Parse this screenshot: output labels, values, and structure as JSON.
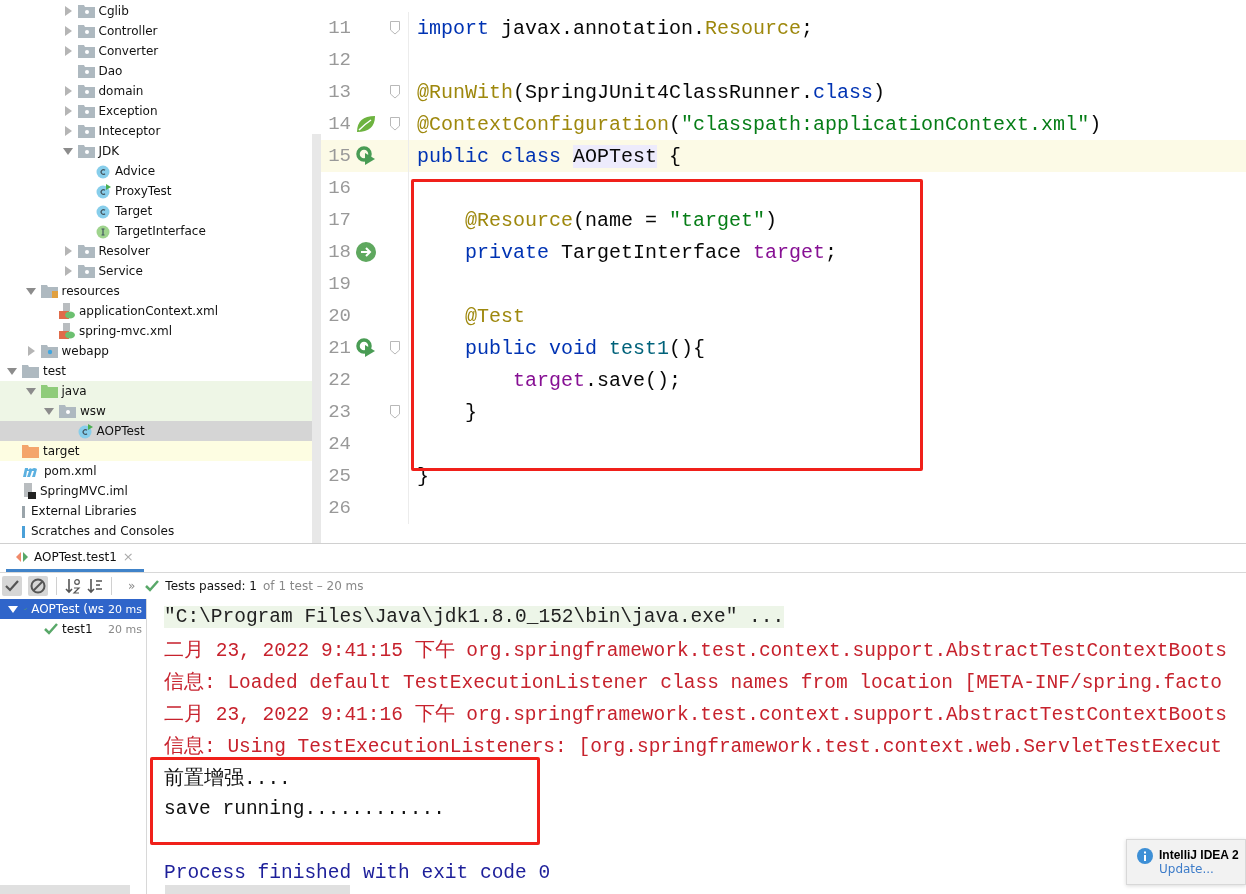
{
  "project_tree": [
    {
      "children": [
        {
          "children": [
            {
              "children": [
                {
                  "label": "Cglib",
                  "kind": "folder",
                  "expanded": false,
                  "selected": false
                },
                {
                  "label": "Controller",
                  "kind": "folder",
                  "expanded": false,
                  "selected": false
                },
                {
                  "label": "Converter",
                  "kind": "folder",
                  "expanded": false,
                  "selected": false
                },
                {
                  "label": "Dao",
                  "kind": "folder",
                  "selected": false
                },
                {
                  "label": "domain",
                  "kind": "folder",
                  "expanded": false,
                  "selected": false
                },
                {
                  "label": "Exception",
                  "kind": "folder",
                  "expanded": false,
                  "selected": false
                },
                {
                  "label": "Inteceptor",
                  "kind": "folder",
                  "expanded": false,
                  "selected": false
                },
                {
                  "label": "JDK",
                  "kind": "folder",
                  "expanded": true,
                  "selected": false,
                  "children": [
                    {
                      "label": "Advice",
                      "kind": "class",
                      "selected": false
                    },
                    {
                      "label": "ProxyTest",
                      "kind": "test-class",
                      "selected": false
                    },
                    {
                      "label": "Target",
                      "kind": "class",
                      "selected": false
                    },
                    {
                      "label": "TargetInterface",
                      "kind": "interface",
                      "selected": false
                    }
                  ]
                },
                {
                  "label": "Resolver",
                  "kind": "folder",
                  "expanded": false,
                  "selected": false
                },
                {
                  "label": "Service",
                  "kind": "folder",
                  "expanded": false,
                  "selected": false
                }
              ]
            }
          ]
        },
        {
          "label": "resources",
          "kind": "resource-folder",
          "expanded": true,
          "selected": false,
          "children": [
            {
              "label": "applicationContext.xml",
              "kind": "xml",
              "selected": false
            },
            {
              "label": "spring-mvc.xml",
              "kind": "xml",
              "selected": false
            }
          ]
        },
        {
          "label": "webapp",
          "kind": "web-folder",
          "expanded": false,
          "selected": false
        }
      ]
    },
    {
      "label": "test",
      "kind": "folder-plain",
      "expanded": true,
      "selected": false,
      "children": [
        {
          "label": "java",
          "kind": "test-root",
          "expanded": true,
          "selected": false,
          "children": [
            {
              "label": "wsw",
              "kind": "folder",
              "expanded": true,
              "selected": false,
              "children": [
                {
                  "label": "AOPTest",
                  "kind": "test-class",
                  "selected": true
                }
              ]
            }
          ]
        }
      ]
    },
    {
      "label": "target",
      "kind": "excluded-folder",
      "selected": false
    },
    {
      "label": "pom.xml",
      "kind": "maven",
      "selected": false
    },
    {
      "label": "SpringMVC.iml",
      "kind": "iml",
      "selected": false
    },
    {
      "label": "External Libraries",
      "kind": "library",
      "selected": false
    },
    {
      "label": "Scratches and Consoles",
      "kind": "scratch",
      "selected": false
    }
  ],
  "editor": {
    "lines": [
      {
        "number": "11",
        "fold": true,
        "tokens": [
          {
            "text": "import",
            "kind": "keyword"
          },
          {
            "text": " javax.annotation.",
            "kind": "plain"
          },
          {
            "text": "Resource",
            "kind": "annotation"
          },
          {
            "text": ";",
            "kind": "plain"
          }
        ]
      },
      {
        "number": "12",
        "fold": false
      },
      {
        "number": "13",
        "fold": true,
        "tokens": [
          {
            "text": "@RunWith",
            "kind": "annotation"
          },
          {
            "text": "(SpringJUnit4ClassRunner.",
            "kind": "plain"
          },
          {
            "text": "class",
            "kind": "keyword"
          },
          {
            "text": ")",
            "kind": "plain"
          }
        ]
      },
      {
        "number": "14",
        "fold": true,
        "kind": "spring",
        "tokens": [
          {
            "text": "@ContextConfiguration",
            "kind": "annotation"
          },
          {
            "text": "(",
            "kind": "plain"
          },
          {
            "text": "\"classpath:applicationContext.xml\"",
            "kind": "string"
          },
          {
            "text": ")",
            "kind": "plain"
          }
        ]
      },
      {
        "number": "15",
        "fold": false,
        "kind": "run",
        "current": true,
        "tokens": [
          {
            "text": "public class ",
            "kind": "keyword"
          },
          {
            "text": "AOPTest",
            "kind": "declaration"
          },
          {
            "text": " {",
            "kind": "plain"
          }
        ]
      },
      {
        "number": "16",
        "fold": false
      },
      {
        "number": "17",
        "fold": false,
        "tokens": [
          {
            "text": "    @Resource",
            "kind": "annotation"
          },
          {
            "text": "(name = ",
            "kind": "plain"
          },
          {
            "text": "\"target\"",
            "kind": "string"
          },
          {
            "text": ")",
            "kind": "plain"
          }
        ]
      },
      {
        "number": "18",
        "fold": false,
        "kind": "bean",
        "tokens": [
          {
            "text": "    private ",
            "kind": "keyword"
          },
          {
            "text": "TargetInterface ",
            "kind": "plain"
          },
          {
            "text": "target",
            "kind": "field"
          },
          {
            "text": ";",
            "kind": "plain"
          }
        ]
      },
      {
        "number": "19",
        "fold": false
      },
      {
        "number": "20",
        "fold": false,
        "tokens": [
          {
            "text": "    @Test",
            "kind": "annotation"
          }
        ]
      },
      {
        "number": "21",
        "fold": true,
        "kind": "run",
        "tokens": [
          {
            "text": "    public void ",
            "kind": "keyword"
          },
          {
            "text": "test1",
            "kind": "method"
          },
          {
            "text": "(){",
            "kind": "plain"
          }
        ]
      },
      {
        "number": "22",
        "fold": false,
        "tokens": [
          {
            "text": "        target",
            "kind": "field"
          },
          {
            "text": ".save();",
            "kind": "plain"
          }
        ]
      },
      {
        "number": "23",
        "fold": true,
        "tokens": [
          {
            "text": "    }",
            "kind": "plain"
          }
        ]
      },
      {
        "number": "24",
        "fold": false
      },
      {
        "number": "25",
        "fold": false,
        "tokens": [
          {
            "text": "}",
            "kind": "plain"
          }
        ]
      },
      {
        "number": "26",
        "fold": false
      }
    ]
  },
  "run_panel": {
    "tab": {
      "label": "AOPTest.test1",
      "close": "×",
      "selected": true
    },
    "toolbar": {
      "more": "»",
      "status": "Tests passed: 1",
      "status_detail": "of 1 test – 20 ms"
    },
    "tests": [
      {
        "label": "AOPTest (ws",
        "time": "20 ms",
        "expanded": true,
        "selected": true,
        "children": [
          {
            "label": "test1",
            "time": "20 ms",
            "selected": false
          }
        ]
      }
    ],
    "console": [
      {
        "kind": "command",
        "text": "\"C:\\Program Files\\Java\\jdk1.8.0_152\\bin\\java.exe\" ..."
      },
      {
        "kind": "log",
        "text": "二月 23, 2022 9:41:15 下午 org.springframework.test.context.support.AbstractTestContextBoots"
      },
      {
        "kind": "log",
        "text": "信息: Loaded default TestExecutionListener class names from location [META-INF/spring.facto"
      },
      {
        "kind": "log",
        "text": "二月 23, 2022 9:41:16 下午 org.springframework.test.context.support.AbstractTestContextBoots"
      },
      {
        "kind": "log",
        "text": "信息: Using TestExecutionListeners: [org.springframework.test.context.web.ServletTestExecut"
      },
      {
        "kind": "output",
        "text": "前置增强...."
      },
      {
        "kind": "output",
        "text": "save running............"
      },
      {
        "kind": "blank"
      },
      {
        "kind": "exit",
        "text": "Process finished with exit code 0"
      }
    ]
  },
  "notification": {
    "title": "IntelliJ IDEA 2",
    "link": "Update..."
  }
}
